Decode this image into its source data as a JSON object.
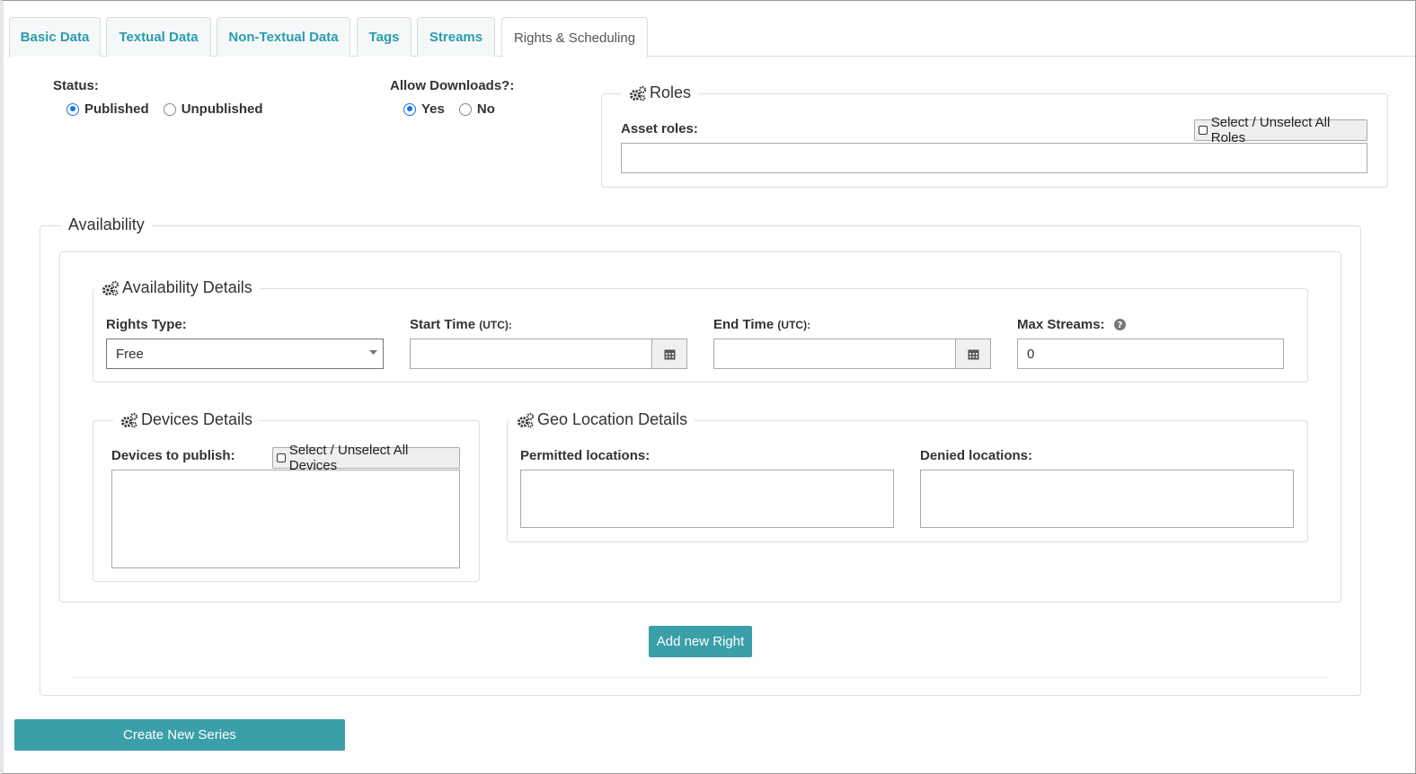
{
  "tabs": [
    {
      "label": "Basic Data"
    },
    {
      "label": "Textual Data"
    },
    {
      "label": "Non-Textual Data"
    },
    {
      "label": "Tags"
    },
    {
      "label": "Streams"
    },
    {
      "label": "Rights & Scheduling",
      "active": true
    }
  ],
  "status": {
    "label": "Status:",
    "options": [
      "Published",
      "Unpublished"
    ],
    "selected": "Published"
  },
  "downloads": {
    "label": "Allow Downloads?:",
    "options": [
      "Yes",
      "No"
    ],
    "selected": "Yes"
  },
  "roles": {
    "legend": "Roles",
    "asset_roles_label": "Asset roles:",
    "select_all_label": "Select / Unselect All Roles",
    "value": ""
  },
  "availability": {
    "legend": "Availability",
    "details": {
      "legend": "Availability Details",
      "rights_type_label": "Rights Type:",
      "rights_type_value": "Free",
      "start_time_label": "Start Time",
      "start_time_unit": "(UTC):",
      "start_time_value": "",
      "end_time_label": "End Time",
      "end_time_unit": "(UTC):",
      "end_time_value": "",
      "max_streams_label": "Max Streams:",
      "max_streams_value": "0"
    },
    "devices": {
      "legend": "Devices Details",
      "devices_label": "Devices to publish:",
      "select_all_label": "Select / Unselect All Devices"
    },
    "geo": {
      "legend": "Geo Location Details",
      "permitted_label": "Permitted locations:",
      "denied_label": "Denied locations:"
    },
    "add_right_label": "Add new Right"
  },
  "create_series_label": "Create New Series",
  "colors": {
    "accent": "#3a9fa9",
    "tab_text": "#2a9cac",
    "radio": "#1a73e8"
  }
}
